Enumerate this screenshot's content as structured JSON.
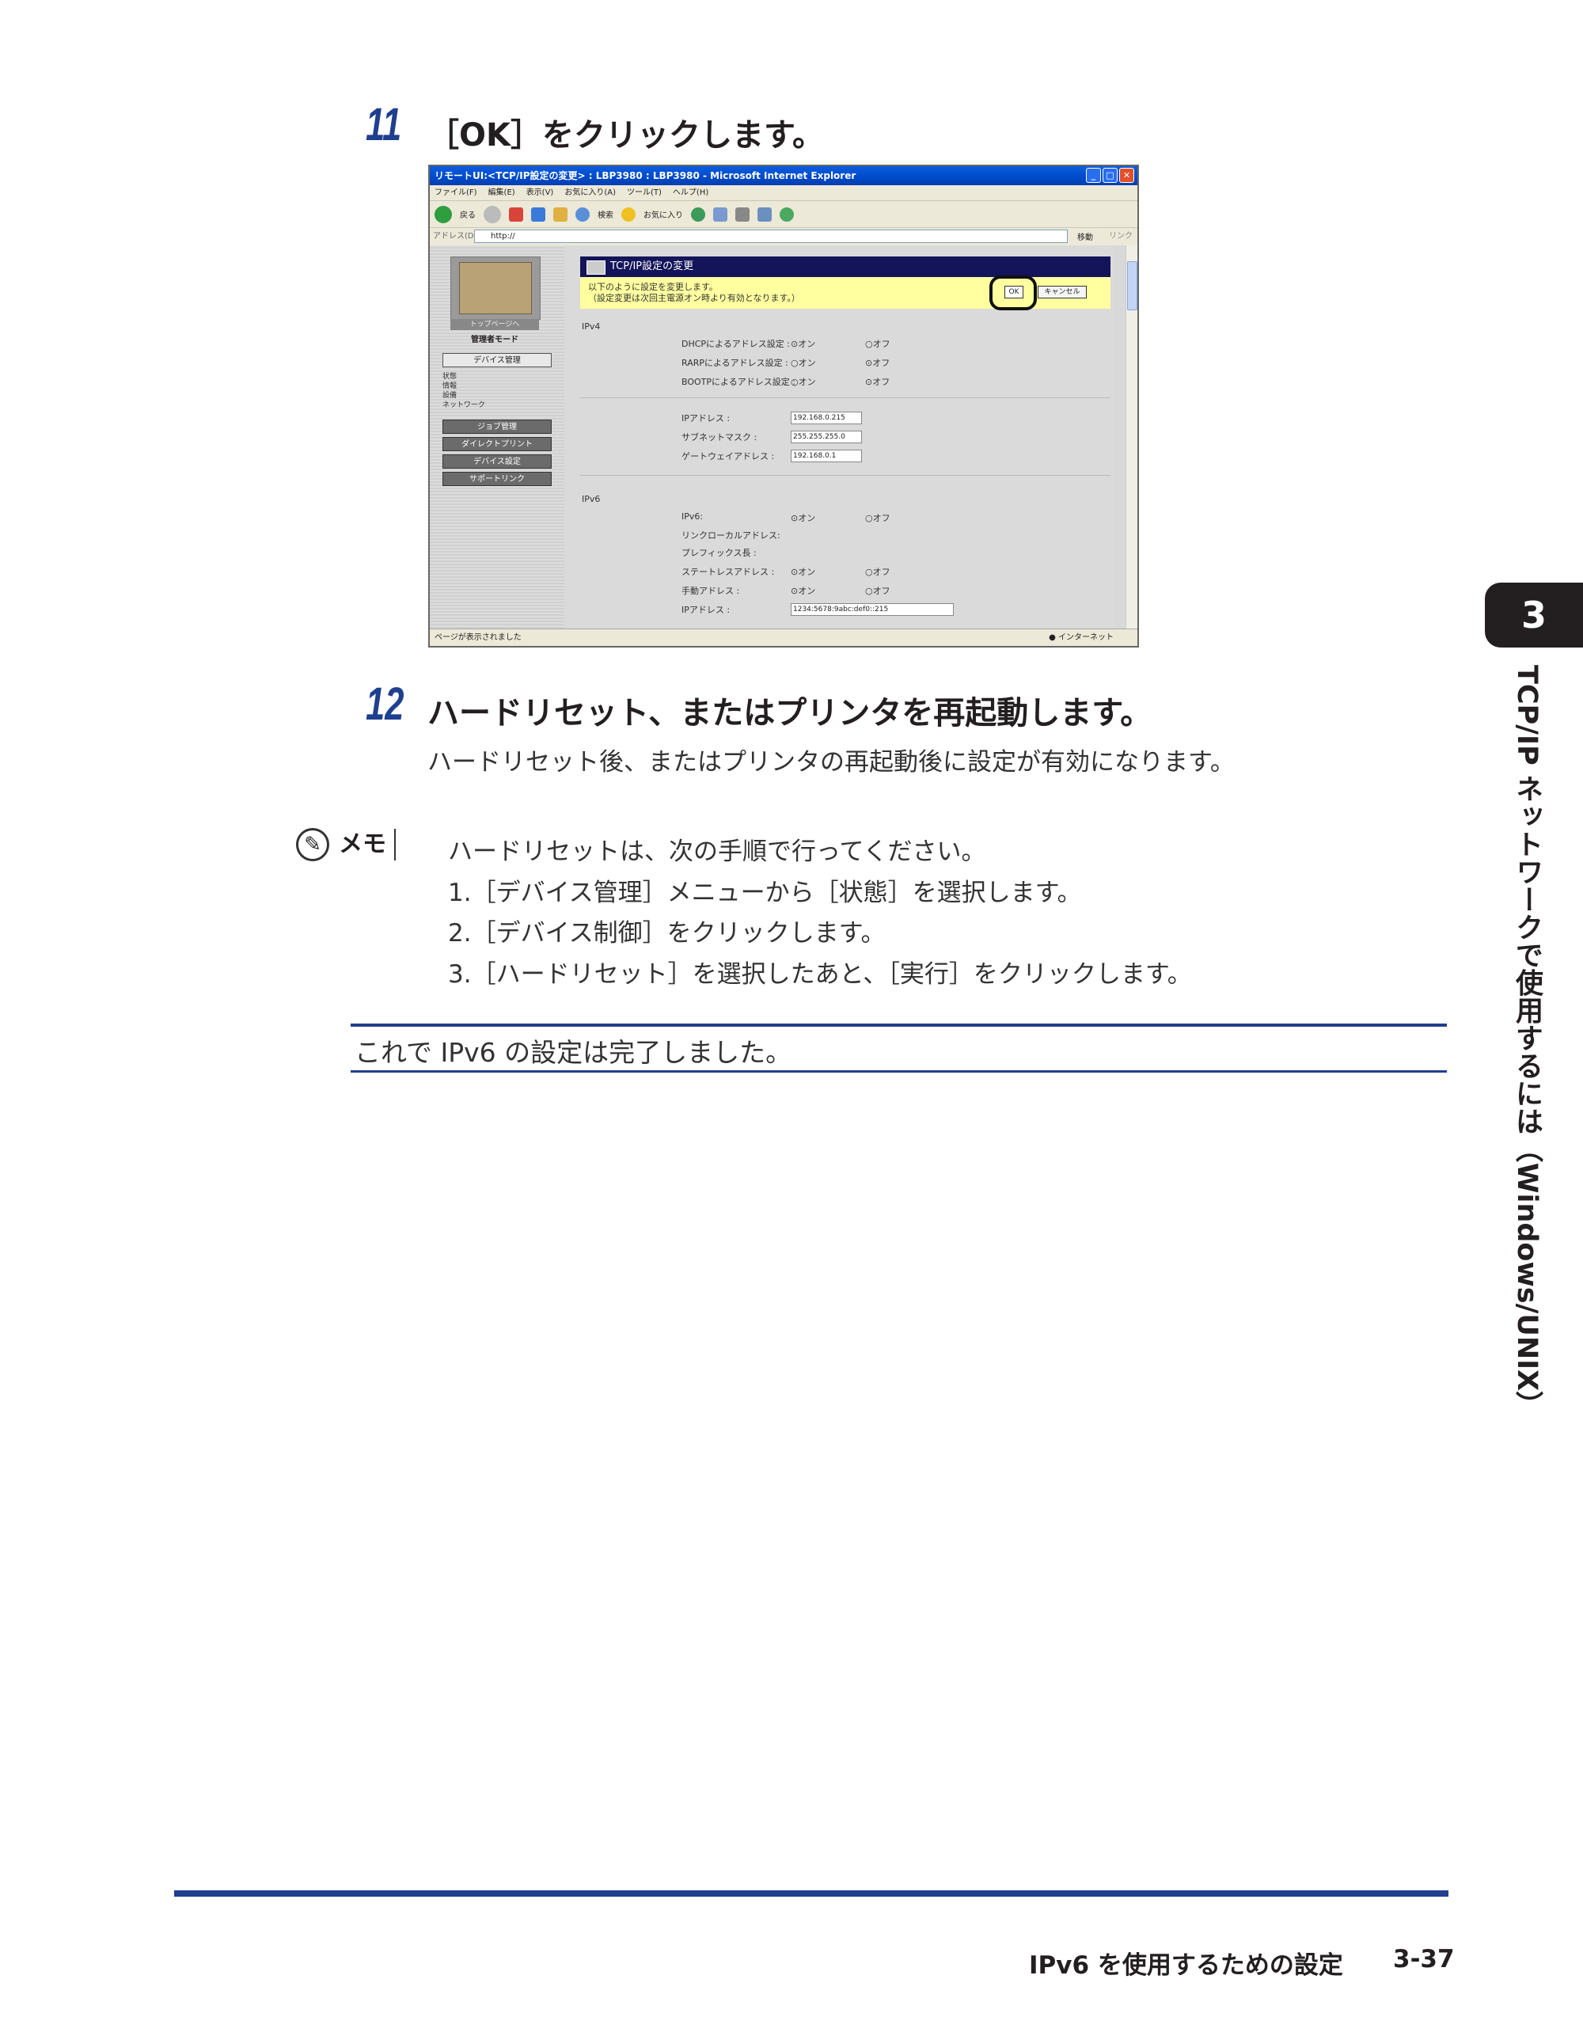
{
  "step11": {
    "number": "11",
    "title": "［OK］をクリックします。"
  },
  "browser": {
    "window_title": "リモートUI:<TCP/IP設定の変更> : LBP3980 : LBP3980 - Microsoft Internet Explorer",
    "menus": [
      "ファイル(F)",
      "編集(E)",
      "表示(V)",
      "お気に入り(A)",
      "ツール(T)",
      "ヘルプ(H)"
    ],
    "toolbar": {
      "back": "戻る",
      "search": "検索",
      "favorites": "お気に入り"
    },
    "address_label": "アドレス(D)",
    "address_value": "http://",
    "go_label": "移動",
    "links_label": "リンク",
    "status_text": "ページが表示されました",
    "zone_text": "インターネット"
  },
  "remote_ui": {
    "nav": {
      "top_page": "トップページへ",
      "mode": "管理者モード",
      "device_mgmt": "デバイス管理",
      "sub_items": [
        "状態",
        "情報",
        "設備",
        "ネットワーク"
      ],
      "buttons": [
        "ジョブ管理",
        "ダイレクトプリント",
        "デバイス設定",
        "サポートリンク"
      ]
    },
    "header": "TCP/IP設定の変更",
    "notice_line1": "以下のように設定を変更します。",
    "notice_line2": "（設定変更は次回主電源オン時より有効となります。）",
    "ok_label": "OK",
    "cancel_label": "キャンセル",
    "ipv4_label": "IPv4",
    "ipv6_label": "IPv6",
    "on_label": "オン",
    "off_label": "オフ",
    "ipv4_radios": [
      {
        "label": "DHCPによるアドレス設定 :",
        "selected": "on"
      },
      {
        "label": "RARPによるアドレス設定 :",
        "selected": "off"
      },
      {
        "label": "BOOTPによるアドレス設定 :",
        "selected": "off"
      }
    ],
    "ipv4_fields": [
      {
        "label": "IPアドレス :",
        "value": "192.168.0.215"
      },
      {
        "label": "サブネットマスク :",
        "value": "255.255.255.0"
      },
      {
        "label": "ゲートウェイアドレス :",
        "value": "192.168.0.1"
      }
    ],
    "ipv6_rows": [
      {
        "label": "IPv6:",
        "selected": "on"
      },
      {
        "label": "リンクローカルアドレス:"
      },
      {
        "label": "プレフィックス長 :"
      },
      {
        "label": "ステートレスアドレス :",
        "selected": "on"
      },
      {
        "label": "手動アドレス :",
        "selected": "on"
      },
      {
        "label": "IPアドレス :",
        "value": "1234:5678:9abc:def0::215"
      }
    ]
  },
  "step12": {
    "number": "12",
    "title": "ハードリセット、またはプリンタを再起動します。",
    "body": "ハードリセット後、またはプリンタの再起動後に設定が有効になります。"
  },
  "memo": {
    "badge": "メモ",
    "intro": "ハードリセットは、次の手順で行ってください。",
    "steps": [
      "1.［デバイス管理］メニューから［状態］を選択します。",
      "2.［デバイス制御］をクリックします。",
      "3.［ハードリセット］を選択したあと、［実行］をクリックします。"
    ]
  },
  "summary": "これで IPv6 の設定は完了しました。",
  "chapter": {
    "number": "3",
    "title": "TCP/IP ネットワークで使用するには（Windows/UNIX）"
  },
  "footer": {
    "title": "IPv6 を使用するための設定",
    "page": "3-37"
  },
  "colors": {
    "accent": "#1f3f8f",
    "notice": "#ffffa0",
    "header": "#14145a"
  }
}
